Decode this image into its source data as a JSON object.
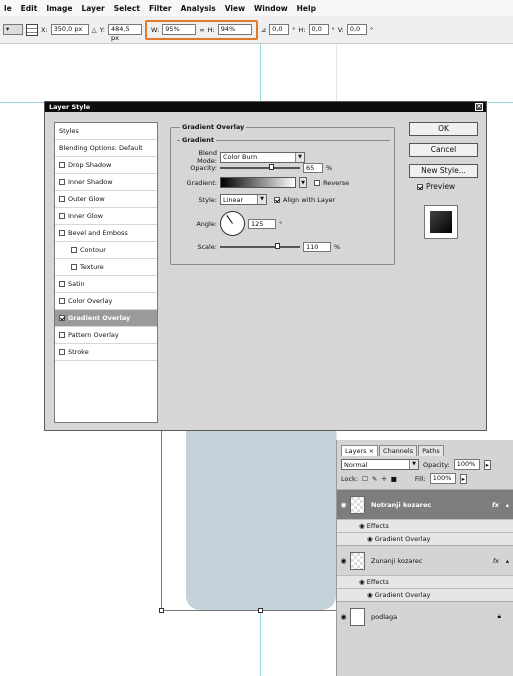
{
  "menubar": {
    "items": [
      "le",
      "Edit",
      "Image",
      "Layer",
      "Select",
      "Filter",
      "Analysis",
      "View",
      "Window",
      "Help"
    ]
  },
  "optionsbar": {
    "x_label": "X:",
    "x_value": "350,0 px",
    "y_label": "Y:",
    "y_value": "484,5 px",
    "w_label": "W:",
    "w_value": "95%",
    "h_label": "H:",
    "h_value": "94%",
    "rot_value": "0,0",
    "h_skew_label": "H:",
    "h_skew_value": "0,0",
    "v_skew_label": "V:",
    "v_skew_value": "0,0",
    "degree": "°"
  },
  "dialog": {
    "title": "Layer Style",
    "styles_list": [
      {
        "label": "Styles",
        "type": "header"
      },
      {
        "label": "Blending Options: Default",
        "type": "header"
      },
      {
        "label": "Drop Shadow",
        "checked": false
      },
      {
        "label": "Inner Shadow",
        "checked": false
      },
      {
        "label": "Outer Glow",
        "checked": false
      },
      {
        "label": "Inner Glow",
        "checked": false
      },
      {
        "label": "Bevel and Emboss",
        "checked": false
      },
      {
        "label": "Contour",
        "checked": false,
        "indent": true
      },
      {
        "label": "Texture",
        "checked": false,
        "indent": true
      },
      {
        "label": "Satin",
        "checked": false
      },
      {
        "label": "Color Overlay",
        "checked": false
      },
      {
        "label": "Gradient Overlay",
        "checked": true,
        "selected": true
      },
      {
        "label": "Pattern Overlay",
        "checked": false
      },
      {
        "label": "Stroke",
        "checked": false
      }
    ],
    "section_title": "Gradient Overlay",
    "subsection_title": "Gradient",
    "blend_mode_label": "Blend Mode:",
    "blend_mode_value": "Color Burn",
    "opacity_label": "Opacity:",
    "opacity_value": "65",
    "opacity_fraction": 0.65,
    "percent": "%",
    "gradient_label": "Gradient:",
    "reverse_label": "Reverse",
    "style_label": "Style:",
    "style_value": "Linear",
    "align_label": "Align with Layer",
    "angle_label": "Angle:",
    "angle_value": "125",
    "degree": "°",
    "scale_label": "Scale:",
    "scale_value": "110",
    "scale_fraction": 0.73,
    "buttons": {
      "ok": "OK",
      "cancel": "Cancel",
      "new_style": "New Style..."
    },
    "preview_label": "Preview"
  },
  "layers_panel": {
    "tabs": [
      "Layers ×",
      "Channels",
      "Paths"
    ],
    "blend_value": "Normal",
    "opacity_label": "Opacity:",
    "opacity_value": "100%",
    "lock_label": "Lock:",
    "fill_label": "Fill:",
    "fill_value": "100%",
    "layers": [
      {
        "name": "Notranji kozarec",
        "selected": true,
        "fx": "fx",
        "effects": "Effects",
        "effect_item": "Gradient Overlay"
      },
      {
        "name": "Zunanji kozarec",
        "selected": false,
        "fx": "fx",
        "effects": "Effects",
        "effect_item": "Gradient Overlay"
      },
      {
        "name": "podlaga",
        "selected": false
      }
    ]
  }
}
